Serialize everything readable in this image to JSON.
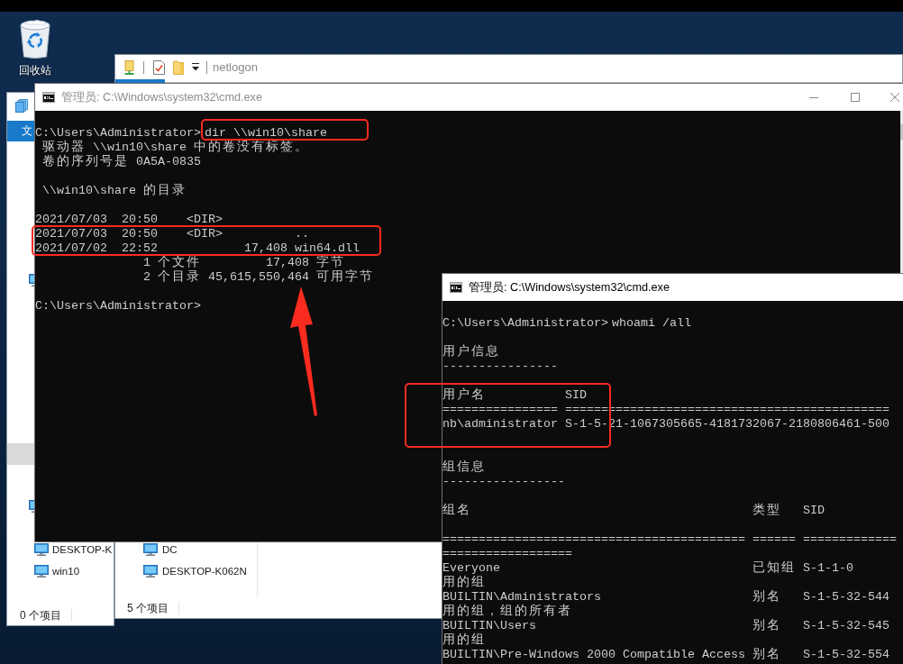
{
  "desktop": {
    "shortcuts": [
      {
        "label": "回收站"
      }
    ]
  },
  "explorer_back": {
    "ribbon_tab": "文",
    "nav_items": [
      {
        "kind": "computer",
        "selected": false
      },
      {
        "kind": "plain",
        "selected": true
      },
      {
        "kind": "computer",
        "selected": false
      }
    ],
    "items": [
      "DESKTOP-K",
      "win10"
    ],
    "status": "0 个项目"
  },
  "explorer_front": {
    "title": "netlogon",
    "items": [
      "DC",
      "DESKTOP-K062N"
    ],
    "status": "5 个项目"
  },
  "consoles": [
    {
      "active": false,
      "title": "管理员: C:\\Windows\\system32\\cmd.exe",
      "lines": [
        {
          "kind": "blank"
        },
        {
          "kind": "command",
          "prompt": "C:\\Users\\Administrator>",
          "command": "dir \\\\win10\\share"
        },
        {
          "kind": "text",
          "text": " 驱动器 \\\\win10\\share 中的卷没有标签。"
        },
        {
          "kind": "text",
          "text": " 卷的序列号是 0A5A-0835"
        },
        {
          "kind": "blank"
        },
        {
          "kind": "text",
          "text": " \\\\win10\\share 的目录"
        },
        {
          "kind": "blank"
        },
        {
          "kind": "text",
          "text": "2021/07/03  20:50    <DIR>"
        },
        {
          "kind": "text",
          "text": "2021/07/03  20:50    <DIR>          .."
        },
        {
          "kind": "text",
          "text": "2021/07/02  22:52            17,408 win64.dll"
        },
        {
          "kind": "text",
          "text": "               1 个文件         17,408 字节"
        },
        {
          "kind": "text",
          "text": "               2 个目录 45,615,550,464 可用字节"
        },
        {
          "kind": "blank"
        },
        {
          "kind": "command",
          "prompt": "C:\\Users\\Administrator>"
        }
      ]
    },
    {
      "active": true,
      "title": "管理员: C:\\Windows\\system32\\cmd.exe",
      "lines": [
        {
          "kind": "blank"
        },
        {
          "kind": "command",
          "prompt": "C:\\Users\\Administrator>",
          "command": "whoami /all"
        },
        {
          "kind": "blank"
        },
        {
          "kind": "text",
          "text": "用户信息"
        },
        {
          "kind": "text",
          "text": "----------------"
        },
        {
          "kind": "blank"
        },
        {
          "kind": "text",
          "text": "用户名           SID"
        },
        {
          "kind": "text",
          "text": "================ ============================================="
        },
        {
          "kind": "text",
          "text": "nb\\administrator S-1-5-21-1067305665-4181732067-2180806461-500"
        },
        {
          "kind": "blank"
        },
        {
          "kind": "blank"
        },
        {
          "kind": "text",
          "text": "组信息"
        },
        {
          "kind": "text",
          "text": "-----------------"
        },
        {
          "kind": "blank"
        },
        {
          "kind": "row",
          "cells": [
            "组名",
            "类型",
            "SID"
          ]
        },
        {
          "kind": "blank"
        },
        {
          "kind": "text",
          "text": "========================================== ====== ============="
        },
        {
          "kind": "text",
          "text": "=================="
        },
        {
          "kind": "row",
          "cells": [
            "Everyone",
            "已知组",
            "S-1-1-0"
          ]
        },
        {
          "kind": "text",
          "text": "用的组"
        },
        {
          "kind": "row",
          "cells": [
            "BUILTIN\\Administrators",
            "别名",
            "S-1-5-32-544"
          ]
        },
        {
          "kind": "text",
          "text": "用的组，组的所有者"
        },
        {
          "kind": "row",
          "cells": [
            "BUILTIN\\Users",
            "别名",
            "S-1-5-32-545"
          ]
        },
        {
          "kind": "text",
          "text": "用的组"
        },
        {
          "kind": "row",
          "cells": [
            "BUILTIN\\Pre-Windows 2000 Compatible Access",
            "别名",
            "S-1-5-32-554"
          ]
        }
      ]
    }
  ],
  "annotations": [
    {
      "kind": "box"
    },
    {
      "kind": "box"
    },
    {
      "kind": "arrow"
    },
    {
      "kind": "box"
    }
  ]
}
